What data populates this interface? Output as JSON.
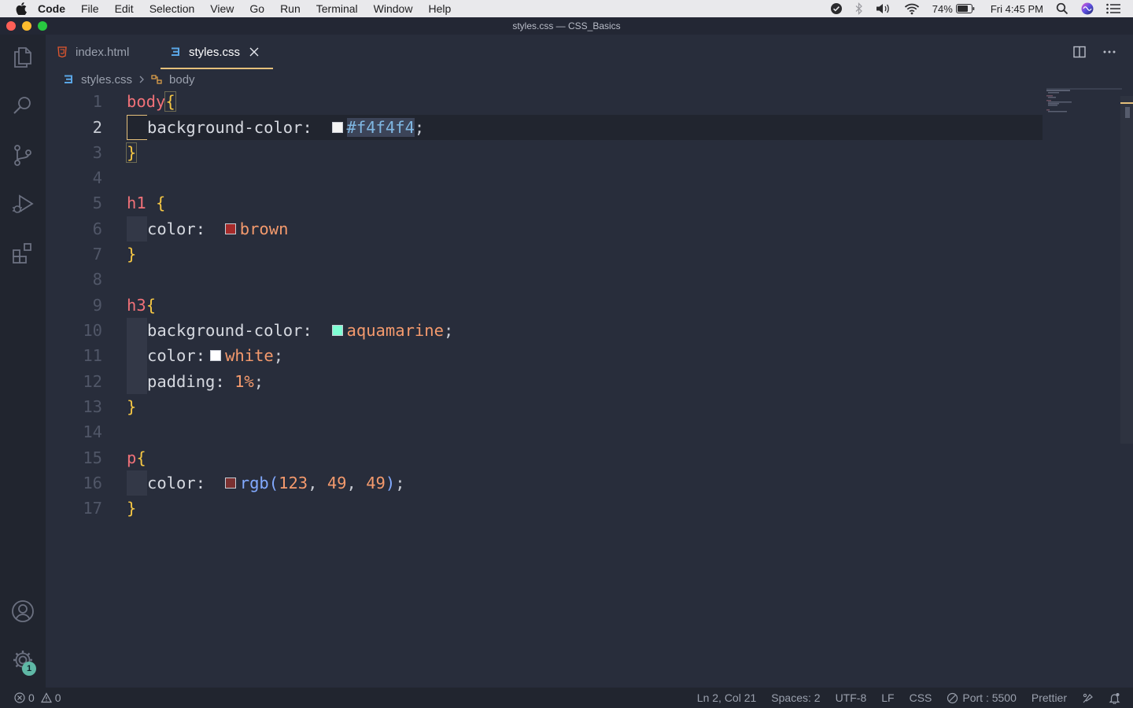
{
  "menubar": {
    "app": "Code",
    "items": [
      "File",
      "Edit",
      "Selection",
      "View",
      "Go",
      "Run",
      "Terminal",
      "Window",
      "Help"
    ],
    "battery": "74%",
    "clock": "Fri 4:45 PM"
  },
  "window": {
    "title": "styles.css — CSS_Basics"
  },
  "tabs": [
    {
      "label": "index.html",
      "icon": "html5-icon",
      "active": false
    },
    {
      "label": "styles.css",
      "icon": "css3-icon",
      "active": true
    }
  ],
  "breadcrumb": {
    "file": "styles.css",
    "symbol": "body"
  },
  "editor": {
    "line_numbers": [
      "1",
      "2",
      "3",
      "4",
      "5",
      "6",
      "7",
      "8",
      "9",
      "10",
      "11",
      "12",
      "13",
      "14",
      "15",
      "16",
      "17"
    ],
    "current_line": 2,
    "tokens": {
      "l1_sel": "body",
      "l1_br": "{",
      "l2_prop": "background-color:",
      "l2_val": "#f4f4f4",
      "l2_semi": ";",
      "l3_br": "}",
      "l5_sel": "h1",
      "l5_br": "{",
      "l6_prop": "color:",
      "l6_val": "brown",
      "l7_br": "}",
      "l9_sel": "h3",
      "l9_br": "{",
      "l10_prop": "background-color:",
      "l10_val": "aquamarine",
      "l10_semi": ";",
      "l11_prop": "color:",
      "l11_val": "white",
      "l11_semi": ";",
      "l12_prop": "padding:",
      "l12_val": "1%",
      "l12_semi": ";",
      "l13_br": "}",
      "l15_sel": "p",
      "l15_br": "{",
      "l16_prop": "color:",
      "l16_fn": "rgb",
      "l16_open": "(",
      "l16_a": "123",
      "l16_c1": ",",
      "l16_b": "49",
      "l16_c2": ",",
      "l16_c": "49",
      "l16_close": ")",
      "l16_semi": ";",
      "l17_br": "}"
    },
    "swatches": {
      "f4f4f4": "#f4f4f4",
      "brown": "#a52a2a",
      "aquamarine": "#7fffd4",
      "white": "#ffffff",
      "rgb": "#7b3131"
    }
  },
  "statusbar": {
    "errors": "0",
    "warnings": "0",
    "position": "Ln 2, Col 21",
    "spaces": "Spaces: 2",
    "encoding": "UTF-8",
    "eol": "LF",
    "language": "CSS",
    "port": "Port : 5500",
    "formatter": "Prettier"
  },
  "activity": {
    "settings_badge": "1"
  },
  "colors": {
    "accent": "#e5c07b",
    "background": "#282d3b",
    "sidebar": "#21252f"
  }
}
